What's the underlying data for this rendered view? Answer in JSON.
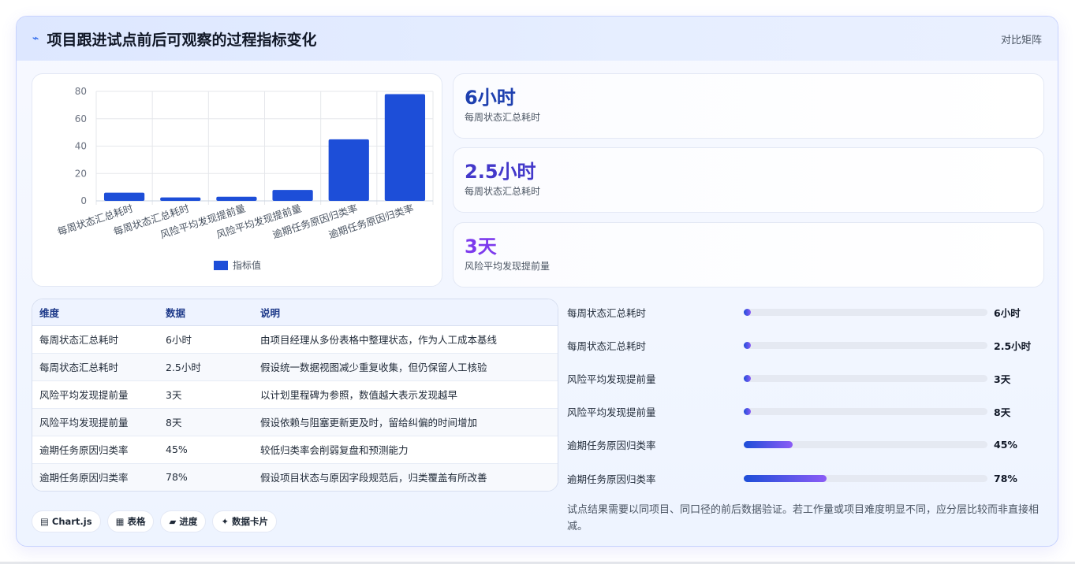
{
  "header": {
    "title": "项目跟进试点前后可观察的过程指标变化",
    "right_label": "对比矩阵"
  },
  "chart_data": {
    "type": "bar",
    "categories": [
      "每周状态汇总耗时",
      "每周状态汇总耗时",
      "风险平均发现提前量",
      "风险平均发现提前量",
      "逾期任务原因归类率",
      "逾期任务原因归类率"
    ],
    "series": [
      {
        "name": "指标值",
        "values": [
          6,
          2.5,
          3,
          8,
          45,
          78
        ],
        "color": "#1d4ed8"
      }
    ],
    "yticks": [
      0,
      20,
      40,
      60,
      80
    ],
    "ylim": [
      0,
      80
    ],
    "grid": true,
    "legend": "bottom"
  },
  "kpis": [
    {
      "value": "6小时",
      "label": "每周状态汇总耗时",
      "color": "#1e40af"
    },
    {
      "value": "2.5小时",
      "label": "每周状态汇总耗时",
      "color": "#4338ca"
    },
    {
      "value": "3天",
      "label": "风险平均发现提前量",
      "color": "#7c3aed"
    }
  ],
  "table": {
    "headers": [
      "维度",
      "数据",
      "说明"
    ],
    "rows": [
      [
        "每周状态汇总耗时",
        "6小时",
        "由项目经理从多份表格中整理状态，作为人工成本基线"
      ],
      [
        "每周状态汇总耗时",
        "2.5小时",
        "假设统一数据视图减少重复收集，但仍保留人工核验"
      ],
      [
        "风险平均发现提前量",
        "3天",
        "以计划里程碑为参照，数值越大表示发现越早"
      ],
      [
        "风险平均发现提前量",
        "8天",
        "假设依赖与阻塞更新更及时，留给纠偏的时间增加"
      ],
      [
        "逾期任务原因归类率",
        "45%",
        "较低归类率会削弱复盘和预测能力"
      ],
      [
        "逾期任务原因归类率",
        "78%",
        "假设项目状态与原因字段规范后，归类覆盖有所改善"
      ]
    ]
  },
  "progress": [
    {
      "label": "每周状态汇总耗时",
      "value": "6小时",
      "fraction": 0
    },
    {
      "label": "每周状态汇总耗时",
      "value": "2.5小时",
      "fraction": 0
    },
    {
      "label": "风险平均发现提前量",
      "value": "3天",
      "fraction": 0
    },
    {
      "label": "风险平均发现提前量",
      "value": "8天",
      "fraction": 0
    },
    {
      "label": "逾期任务原因归类率",
      "value": "45%",
      "fraction": 0.2
    },
    {
      "label": "逾期任务原因归类率",
      "value": "78%",
      "fraction": 0.34
    }
  ],
  "note": "试点结果需要以同项目、同口径的前后数据验证。若工作量或项目难度明显不同，应分层比较而非直接相减。",
  "tags": [
    {
      "icon": "▤",
      "icon_name": "chart-icon",
      "label": "Chart.js"
    },
    {
      "icon": "▦",
      "icon_name": "table-icon",
      "label": "表格"
    },
    {
      "icon": "▰",
      "icon_name": "progress-icon",
      "label": "进度"
    },
    {
      "icon": "✦",
      "icon_name": "sparkle-icon",
      "label": "数据卡片"
    }
  ]
}
